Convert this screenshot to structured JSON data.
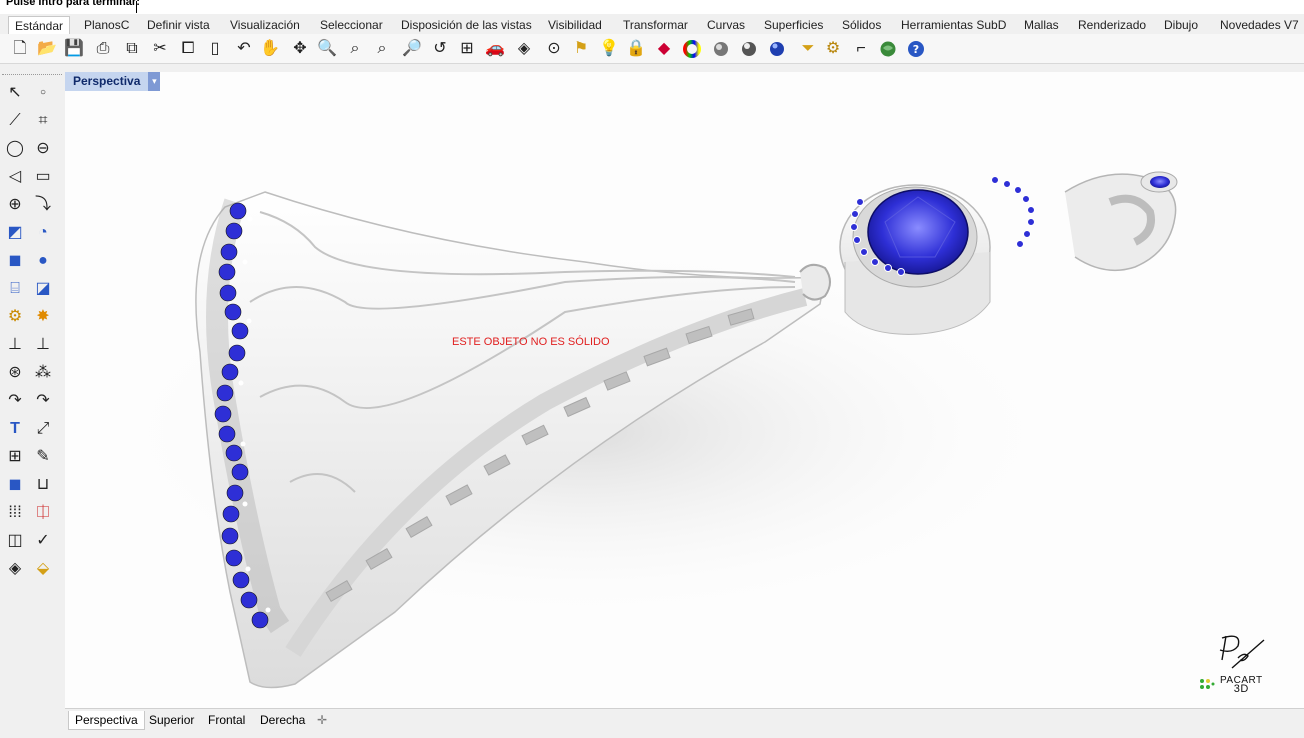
{
  "command_prompt": "Pulse Intro para terminar:",
  "tabs": [
    "Estándar",
    "PlanosC",
    "Definir vista",
    "Visualización",
    "Seleccionar",
    "Disposición de las vistas",
    "Visibilidad",
    "Transformar",
    "Curvas",
    "Superficies",
    "Sólidos",
    "Herramientas SubD",
    "Mallas",
    "Renderizado",
    "Dibujo",
    "Novedades V7"
  ],
  "active_tab": "Estándar",
  "toolbar_icons": [
    "new-file-icon",
    "open-folder-icon",
    "save-icon",
    "print-icon",
    "import-icon",
    "cut-icon",
    "copy-icon",
    "paste-icon",
    "undo-icon",
    "pan-hand-icon",
    "rotate-view-icon",
    "zoom-icon",
    "zoom-window-icon",
    "zoom-extents-icon",
    "zoom-selected-icon",
    "undo-view-icon",
    "four-viewports-icon",
    "car-icon",
    "construction-plane-icon",
    "point-filter-icon",
    "display-mode-icon",
    "light-icon",
    "lock-icon",
    "layer-icon",
    "color-icon",
    "material-sphere-icon",
    "render-sphere-icon",
    "render-blue-icon",
    "filter-icon",
    "settings-gear-icon",
    "grasshopper-icon",
    "globe-icon",
    "help-icon"
  ],
  "left_tools": [
    "select-arrow-icon",
    "point-icon",
    "polyline-icon",
    "curve-control-icon",
    "circle-icon",
    "ellipse-icon",
    "arc-icon",
    "rectangle-icon",
    "polygon-icon",
    "fillet-curve-icon",
    "surface-icon",
    "revolve-icon",
    "box-icon",
    "sphere-icon",
    "cylinder-icon",
    "mesh-surface-icon",
    "gear-icon",
    "explode-icon",
    "trim-icon",
    "split-icon",
    "boolean-icon",
    "join-icon",
    "offset-icon",
    "blend-icon",
    "text-icon",
    "scale-icon",
    "grid-array-icon",
    "properties-icon",
    "solid-box-icon",
    "dimension-icon",
    "array-icon",
    "history-icon",
    "analyze-icon",
    "check-icon",
    "render-icon",
    "paint-icon"
  ],
  "viewport": {
    "title": "Perspectiva",
    "warning": "ESTE OBJETO NO ES SÓLIDO",
    "logo_text_line1": "PACART",
    "logo_text_line2": "3D"
  },
  "bottom_tabs": [
    "Perspectiva",
    "Superior",
    "Frontal",
    "Derecha"
  ],
  "active_bottom_tab": "Perspectiva",
  "colors": {
    "accent": "#7e99d4",
    "warning": "#e02020",
    "gem": "#2e2fd6"
  }
}
